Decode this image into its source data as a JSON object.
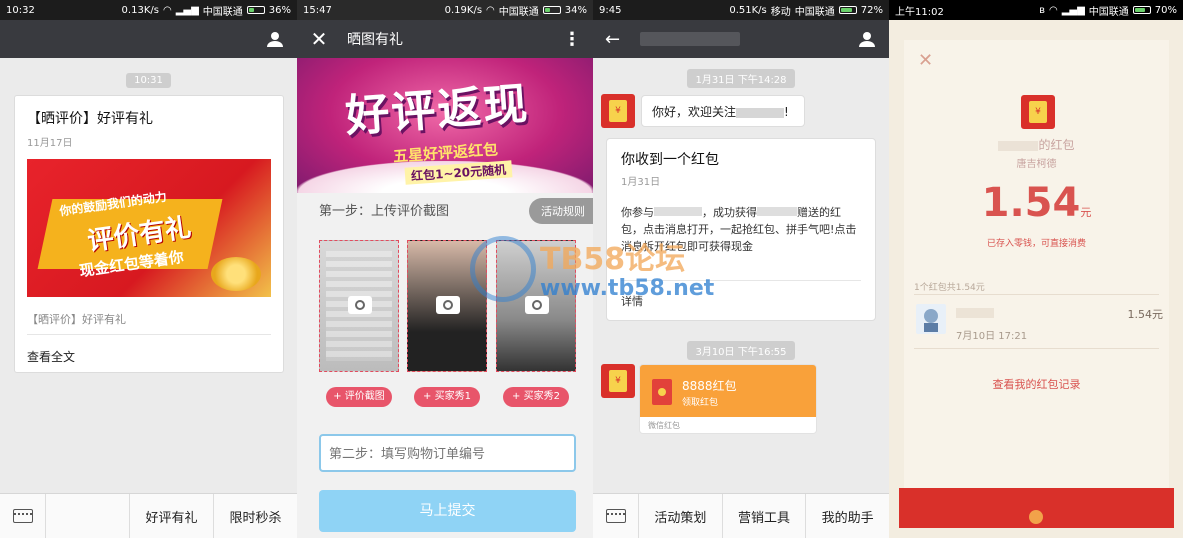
{
  "panel1": {
    "status": {
      "time": "10:32",
      "speed": "0.13K/s",
      "carrier": "中国联通",
      "battery": "36%",
      "battery_level": 0.36
    },
    "timestamp": "10:31",
    "article": {
      "title": "【晒评价】好评有礼",
      "date": "11月17日",
      "banner_line1": "你的鼓励我们的动力",
      "banner_line2": "评价有礼",
      "banner_line3": "现金红包等着你",
      "summary": "【晒评价】好评有礼",
      "read_more": "查看全文"
    },
    "menu": [
      "好评有礼",
      "限时秒杀"
    ]
  },
  "panel2": {
    "status": {
      "time": "15:47",
      "speed": "0.19K/s",
      "carrier": "中国联通",
      "battery": "34%",
      "battery_level": 0.34
    },
    "title": "晒图有礼",
    "banner_main": "好评返现",
    "banner_sub1": "五星好评返红包",
    "banner_sub2": "红包1~20元随机",
    "step1": "第一步：上传评价截图",
    "rules_button": "活动规则",
    "upload_labels": [
      "+ 评价截图",
      "+ 买家秀1",
      "+ 买家秀2"
    ],
    "order_placeholder": "第二步：填写购物订单编号",
    "submit": "马上提交"
  },
  "panel3": {
    "status": {
      "time": "9:45",
      "speed": "0.51K/s",
      "carrier1": "移动",
      "carrier2": "中国联通",
      "battery": "72%",
      "battery_level": 0.72
    },
    "time1": "1月31日 下午14:28",
    "greeting": "你好，欢迎关注",
    "card": {
      "title": "你收到一个红包",
      "date": "1月31日",
      "body_pre": "你参与",
      "body_mid": "，成功获得",
      "body_end": "赠送的红包，点击消息打开，一起抢红包、拼手气吧!点击消息拆开红包即可获得现金",
      "details": "详情"
    },
    "time2": "3月10日 下午16:55",
    "packet": {
      "name": "8888红包",
      "action": "领取红包",
      "footer": "微信红包"
    },
    "menu": [
      "活动策划",
      "营销工具",
      "我的助手"
    ]
  },
  "panel4": {
    "status": {
      "time": "上午11:02",
      "carrier": "中国联通",
      "battery": "70%",
      "battery_level": 0.7
    },
    "packet_of": "的红包",
    "sender": "唐吉柯德",
    "amount": "1.54",
    "unit": "元",
    "note": "已存入零钱，可直接消费",
    "summary": "1个红包共1.54元",
    "record": {
      "time": "7月10日  17:21",
      "amount": "1.54元"
    },
    "history_link": "查看我的红包记录"
  },
  "watermark": {
    "text1": "TB58论坛",
    "text2": "www.tb58.net"
  },
  "colors": {
    "wechat_dark": "#393a3f",
    "red": "#d9302a",
    "orange": "#f9a13a",
    "blue_button": "#8fd3f5",
    "pink": "#e8556a"
  }
}
